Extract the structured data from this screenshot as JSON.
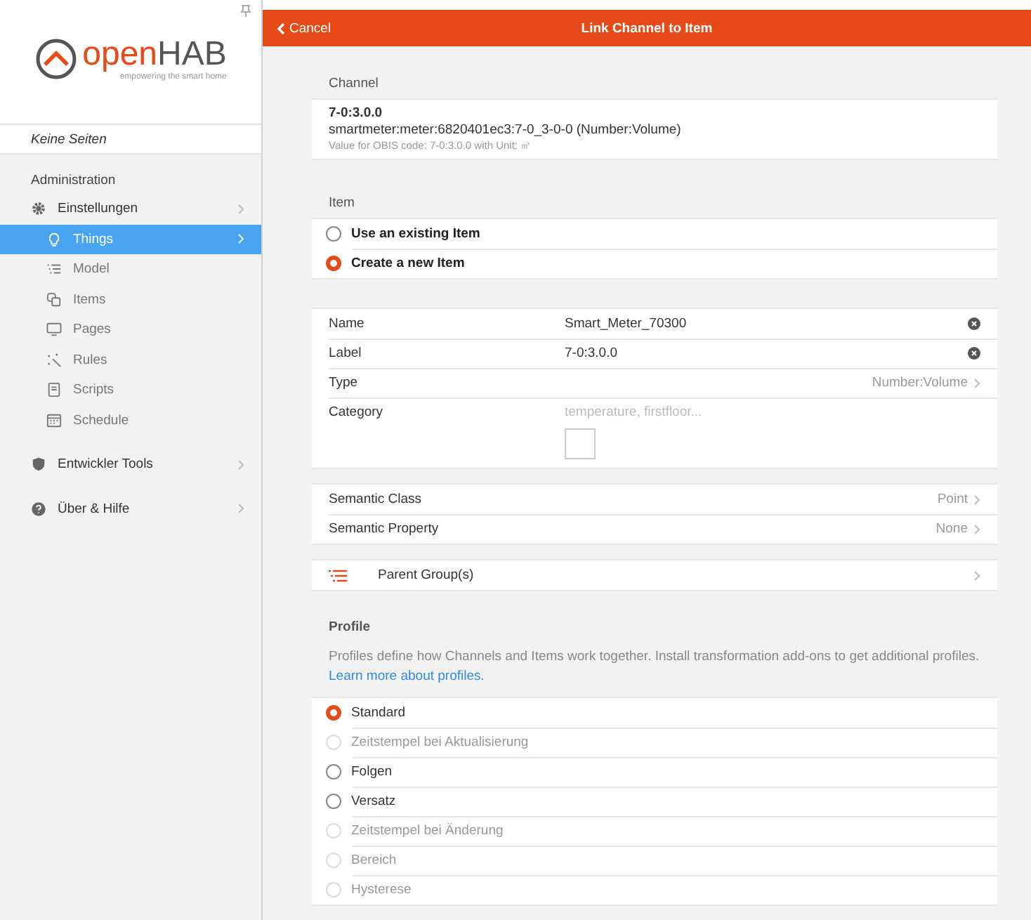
{
  "sidebar": {
    "logo": {
      "word_1": "open",
      "word_2": "HAB",
      "tagline": "empowering the smart home"
    },
    "pages_label": "Keine Seiten",
    "section": "Administration",
    "items": [
      {
        "label": "Einstellungen",
        "kind": "gear",
        "expanded": true,
        "selected": false,
        "children": [
          {
            "label": "Things",
            "kind": "bulb",
            "selected": true
          },
          {
            "label": "Model",
            "kind": "list",
            "selected": false
          },
          {
            "label": "Items",
            "kind": "squares",
            "selected": false
          },
          {
            "label": "Pages",
            "kind": "monitor",
            "selected": false
          },
          {
            "label": "Rules",
            "kind": "wand",
            "selected": false
          },
          {
            "label": "Scripts",
            "kind": "doc",
            "selected": false
          },
          {
            "label": "Schedule",
            "kind": "calendar",
            "selected": false
          }
        ]
      },
      {
        "label": "Entwickler Tools",
        "kind": "shield",
        "expanded": false,
        "selected": false
      },
      {
        "label": "Über & Hilfe",
        "kind": "help",
        "expanded": false,
        "selected": false
      }
    ]
  },
  "header": {
    "cancel": "Cancel",
    "title": "Link Channel to Item"
  },
  "channel": {
    "heading": "Channel",
    "title": "7-0:3.0.0",
    "uid": "smartmeter:meter:6820401ec3:7-0_3-0-0 (Number:Volume)",
    "description": "Value for OBIS code: 7-0:3.0.0 with Unit: ㎥"
  },
  "item": {
    "heading": "Item",
    "options": [
      {
        "label": "Use an existing Item",
        "selected": false
      },
      {
        "label": "Create a new Item",
        "selected": true
      }
    ]
  },
  "fields": [
    {
      "kind": "text",
      "label": "Name",
      "value": "Smart_Meter_70300"
    },
    {
      "kind": "text",
      "label": "Label",
      "value": "7-0:3.0.0"
    },
    {
      "kind": "select",
      "label": "Type",
      "value": "Number:Volume"
    },
    {
      "kind": "category",
      "label": "Category",
      "placeholder": "temperature, firstfloor..."
    }
  ],
  "semantics": [
    {
      "label": "Semantic Class",
      "value": "Point"
    },
    {
      "label": "Semantic Property",
      "value": "None"
    }
  ],
  "parent_group": {
    "label": "Parent Group(s)"
  },
  "profile": {
    "heading": "Profile",
    "description": "Profiles define how Channels and Items work together. Install transformation add-ons to get additional profiles.",
    "link": "Learn more about profiles.",
    "options": [
      {
        "label": "Standard",
        "selected": true,
        "disabled": false
      },
      {
        "label": "Zeitstempel bei Aktualisierung",
        "selected": false,
        "disabled": true
      },
      {
        "label": "Folgen",
        "selected": false,
        "disabled": false
      },
      {
        "label": "Versatz",
        "selected": false,
        "disabled": false
      },
      {
        "label": "Zeitstempel bei Änderung",
        "selected": false,
        "disabled": true
      },
      {
        "label": "Bereich",
        "selected": false,
        "disabled": true
      },
      {
        "label": "Hysterese",
        "selected": false,
        "disabled": true
      }
    ]
  }
}
